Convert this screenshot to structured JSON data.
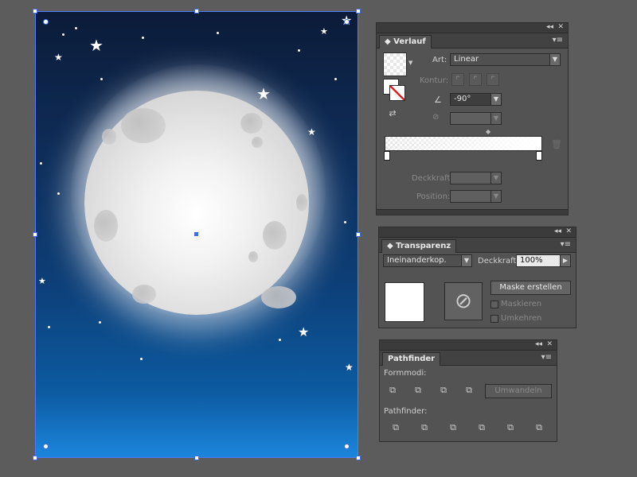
{
  "verlauf": {
    "tab": "Verlauf",
    "art_label": "Art:",
    "art_value": "Linear",
    "kontur_label": "Kontur:",
    "angle_value": "-90°",
    "deckkraft_label": "Deckkraft:",
    "position_label": "Position:"
  },
  "transparenz": {
    "tab": "Transparenz",
    "blend_mode": "Ineinanderkop.",
    "deckkraft_label": "Deckkraft:",
    "deckkraft_value": "100%",
    "mask_button": "Maske erstellen",
    "maskieren_label": "Maskieren",
    "umkehren_label": "Umkehren"
  },
  "pathfinder": {
    "tab": "Pathfinder",
    "formmodi_label": "Formmodi:",
    "umwandeln_button": "Umwandeln",
    "pathfinder_label": "Pathfinder:"
  },
  "colors": {
    "panel_bg": "#535353",
    "selection": "#3f6fe0",
    "sky_top": "#0c1b38",
    "sky_bottom": "#1c86dd"
  }
}
